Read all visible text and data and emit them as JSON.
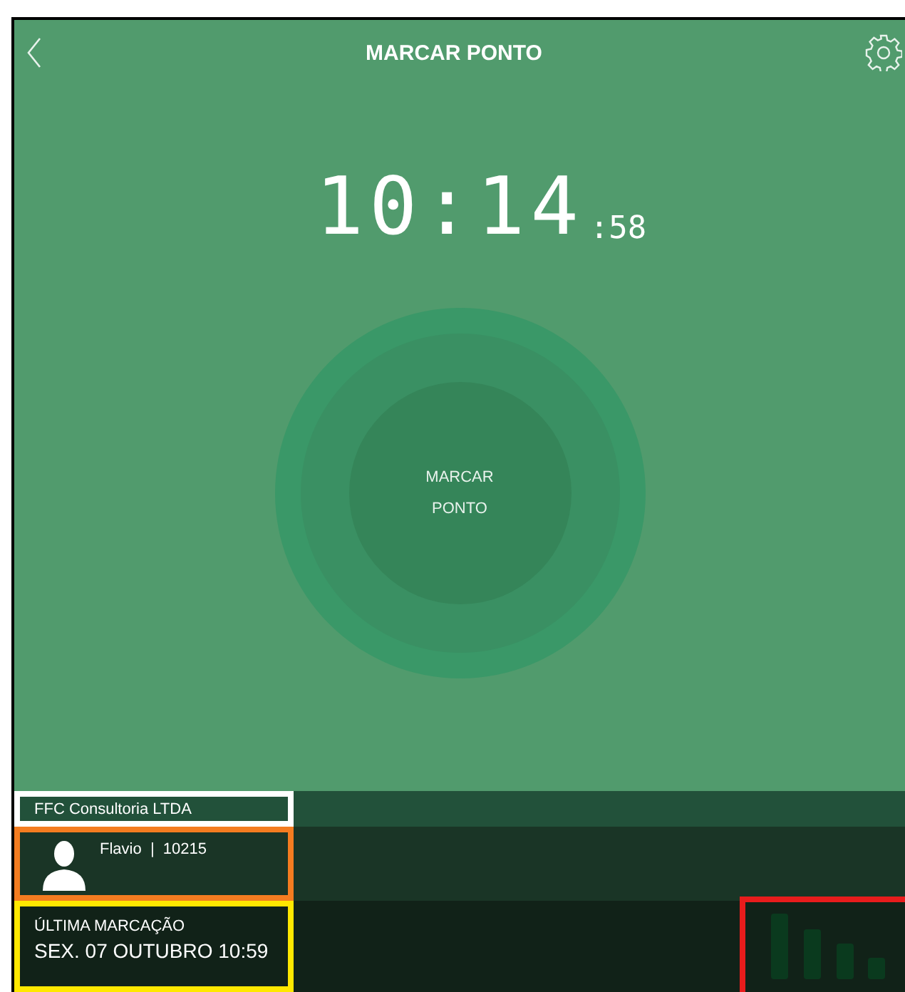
{
  "header": {
    "title": "MARCAR PONTO"
  },
  "clock": {
    "time": "10:14",
    "seconds": ":58"
  },
  "punch_button": {
    "label": "MARCAR PONTO"
  },
  "company": {
    "name": "FFC Consultoria LTDA"
  },
  "user": {
    "text": "Flavio  |  10215"
  },
  "last_punch": {
    "label": "ÚLTIMA MARCAÇÃO",
    "value": "SEX. 07 OUTUBRO 10:59"
  }
}
